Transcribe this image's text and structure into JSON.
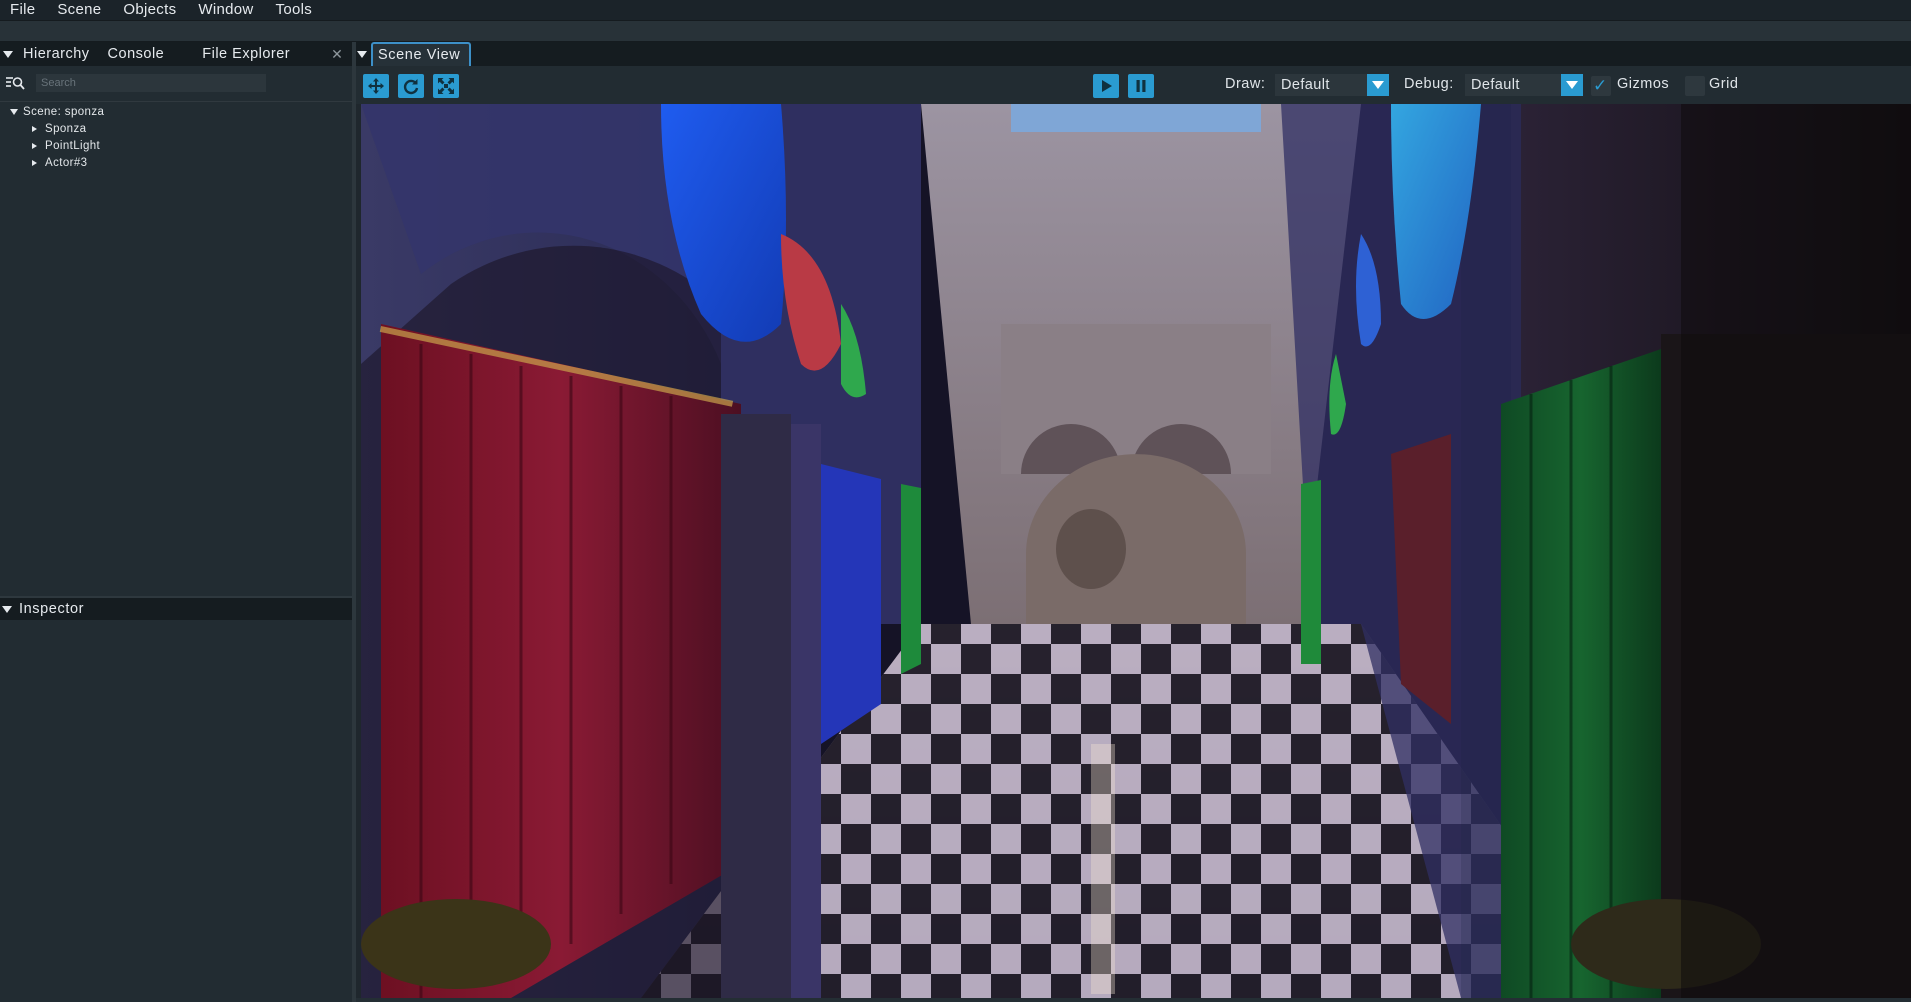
{
  "menu": {
    "items": [
      "File",
      "Scene",
      "Objects",
      "Window",
      "Tools"
    ]
  },
  "left_panel": {
    "tabs": [
      "Hierarchy",
      "Console",
      "File Explorer"
    ],
    "search_placeholder": "Search",
    "tree": {
      "root_label": "Scene: sponza",
      "children": [
        "Sponza",
        "PointLight",
        "Actor#3"
      ]
    },
    "inspector_title": "Inspector"
  },
  "scene_view": {
    "tab_label": "Scene View",
    "toolbar": {
      "draw_label": "Draw:",
      "draw_value": "Default",
      "debug_label": "Debug:",
      "debug_value": "Default",
      "gizmos_label": "Gizmos",
      "gizmos_checked": true,
      "grid_label": "Grid",
      "grid_checked": false
    }
  },
  "colors": {
    "accent": "#2a9bd1",
    "panel_bg": "#222c32",
    "header_bg": "#151c20"
  }
}
